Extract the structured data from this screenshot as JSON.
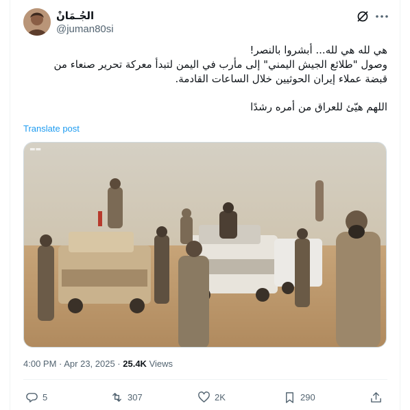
{
  "author": {
    "name": "الجُـمَانْ",
    "handle": "@juman80si"
  },
  "tweet": {
    "lines": [
      "هي لله هي لله... أبشروا بالنصر!",
      "وصول \"طلائع الجيش اليمني\" إلى مأرب في اليمن لتبدأ معركة تحرير صنعاء من",
      "قبضة عملاء إيران الحوثيين خلال الساعات القادمة.",
      "اللهم هيّئ للعراق من أمره رشدًا"
    ],
    "translate_label": "Translate post"
  },
  "meta": {
    "time": "4:00 PM · Apr 23, 2025 · ",
    "views_count": "25.4K",
    "views_label": " Views"
  },
  "actions": {
    "replies": "5",
    "reposts": "307",
    "likes": "2K",
    "bookmarks": "290"
  },
  "icons": [
    "grok-icon",
    "more-icon",
    "reply-icon",
    "repost-icon",
    "like-icon",
    "bookmark-icon",
    "share-icon"
  ],
  "colors": {
    "accent": "#1d9bf0",
    "secondary_text": "#536471",
    "border": "#eff3f4"
  }
}
